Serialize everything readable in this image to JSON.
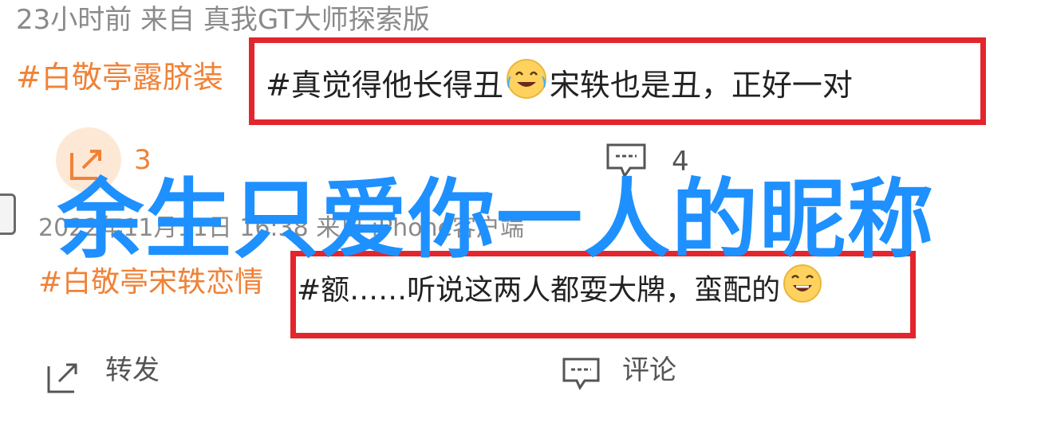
{
  "post1": {
    "meta": "23小时前  来自 真我GT大师探索版",
    "hashtag": "#白敬亭露脐装",
    "text_before_emoji": "#真觉得他长得丑",
    "text_after_emoji": "宋轶也是丑，正好一对",
    "share_count": "3",
    "comment_count": "4"
  },
  "overlay": {
    "title": "余生只爱你一人的昵称"
  },
  "post2": {
    "meta": "2022年11月11日 16:38 来自 iPhone客户端",
    "hashtag": "#白敬亭宋轶恋情",
    "text": "#额……听说这两人都耍大牌，蛮配的",
    "repost_label": "转发",
    "comment_label": "评论"
  },
  "colors": {
    "hashtag": "#f08238",
    "highlight_box": "#e3262d",
    "overlay_title": "#1e90ff",
    "meta": "#8a8a8a"
  },
  "icons": {
    "share": "share-icon",
    "comment": "comment-icon",
    "crying_laughing": "crying-laughing-emoji",
    "laughing": "laughing-emoji"
  }
}
